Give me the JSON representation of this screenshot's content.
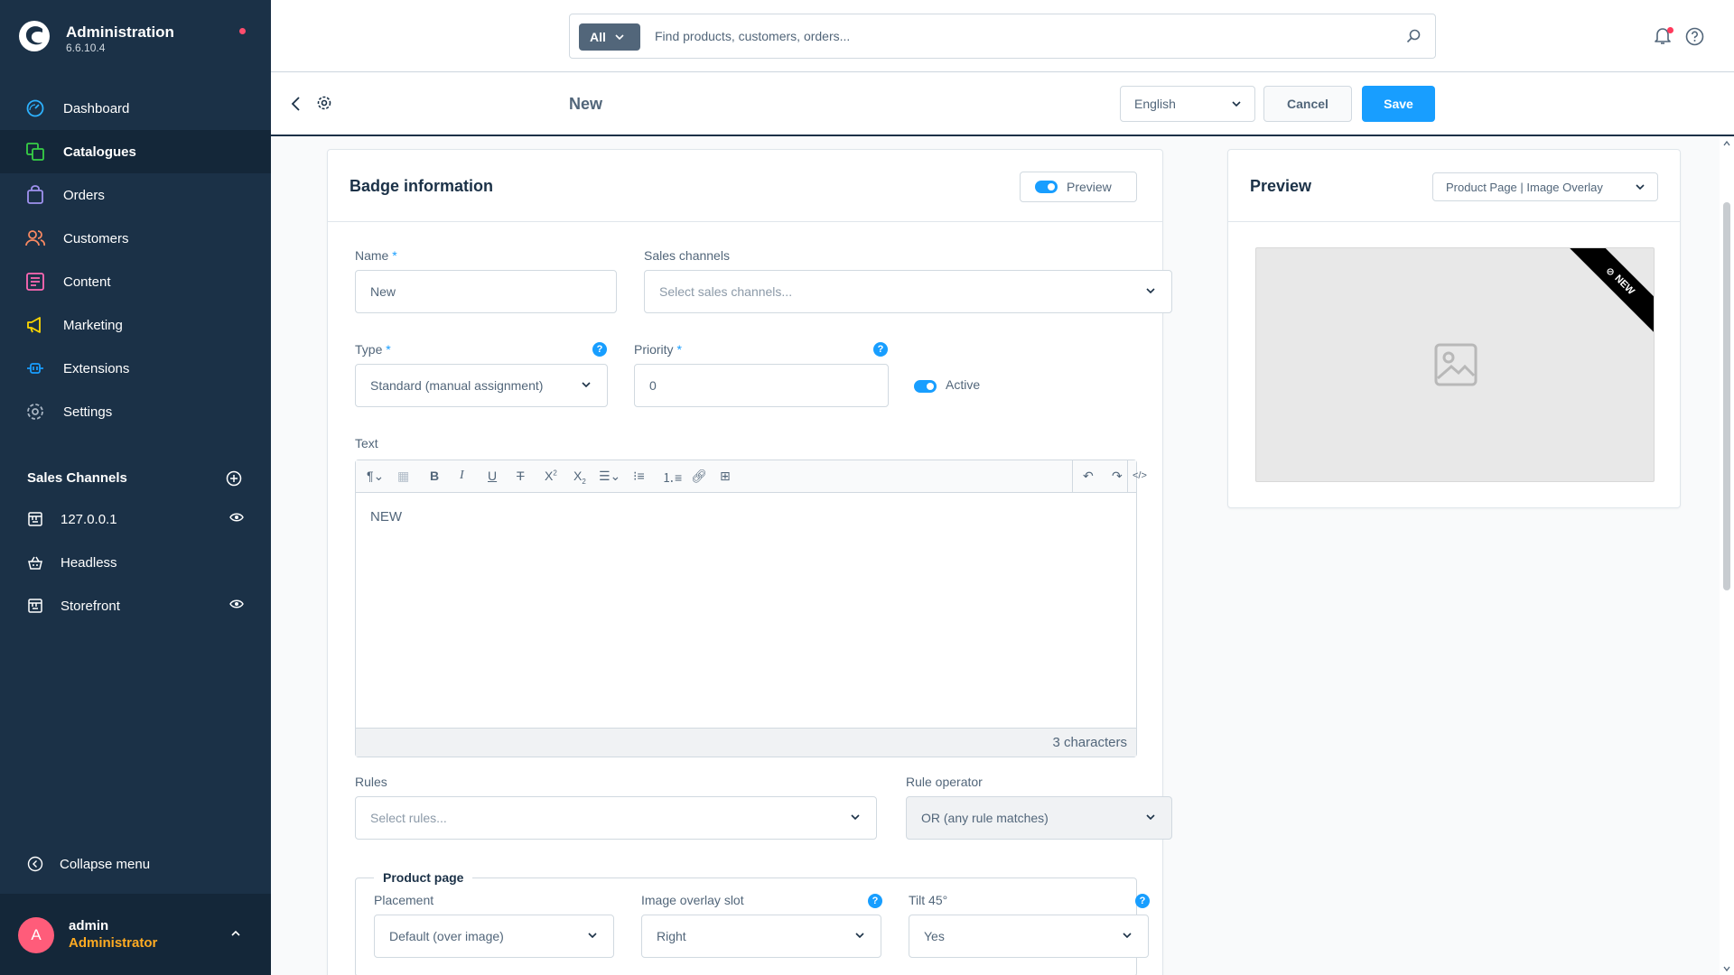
{
  "app": {
    "title": "Administration",
    "version": "6.6.10.4"
  },
  "colors": {
    "sidebar": "#1b3147",
    "accent": "#189eff",
    "role": "#ffab22",
    "avatar": "#ff5c7a"
  },
  "sidebar": {
    "nav": [
      {
        "label": "Dashboard",
        "icon": "dashboard-icon",
        "active": false
      },
      {
        "label": "Catalogues",
        "icon": "catalogues-icon",
        "active": true
      },
      {
        "label": "Orders",
        "icon": "orders-icon",
        "active": false
      },
      {
        "label": "Customers",
        "icon": "customers-icon",
        "active": false
      },
      {
        "label": "Content",
        "icon": "content-icon",
        "active": false
      },
      {
        "label": "Marketing",
        "icon": "marketing-icon",
        "active": false
      },
      {
        "label": "Extensions",
        "icon": "extensions-icon",
        "active": false
      },
      {
        "label": "Settings",
        "icon": "settings-icon",
        "active": false
      }
    ],
    "sales_channels_title": "Sales Channels",
    "sales_channels": [
      {
        "label": "127.0.0.1",
        "has_eye": true
      },
      {
        "label": "Headless",
        "has_eye": false
      },
      {
        "label": "Storefront",
        "has_eye": true
      }
    ],
    "collapse_label": "Collapse menu",
    "user": {
      "initial": "A",
      "name": "admin",
      "role": "Administrator"
    }
  },
  "topbar": {
    "search_scope": "All",
    "search_placeholder": "Find products, customers, orders..."
  },
  "smartbar": {
    "title": "New",
    "language": "English",
    "cancel": "Cancel",
    "save": "Save"
  },
  "badge_card": {
    "title": "Badge information",
    "preview_toggle": "Preview",
    "name_label": "Name",
    "name_value": "New",
    "sales_channels_label": "Sales channels",
    "sales_channels_placeholder": "Select sales channels...",
    "type_label": "Type",
    "type_value": "Standard (manual assignment)",
    "priority_label": "Priority",
    "priority_value": "0",
    "active_label": "Active",
    "text_label": "Text",
    "text_value": "NEW",
    "char_count": "3 characters",
    "rules_label": "Rules",
    "rules_placeholder": "Select rules...",
    "rule_operator_label": "Rule operator",
    "rule_operator_value": "OR (any rule matches)",
    "product_page_legend": "Product page",
    "placement_label": "Placement",
    "placement_value": "Default (over image)",
    "overlay_slot_label": "Image overlay slot",
    "overlay_slot_value": "Right",
    "tilt_label": "Tilt 45°",
    "tilt_value": "Yes"
  },
  "preview_card": {
    "title": "Preview",
    "mode": "Product Page | Image Overlay",
    "ribbon_text": "NEW"
  }
}
